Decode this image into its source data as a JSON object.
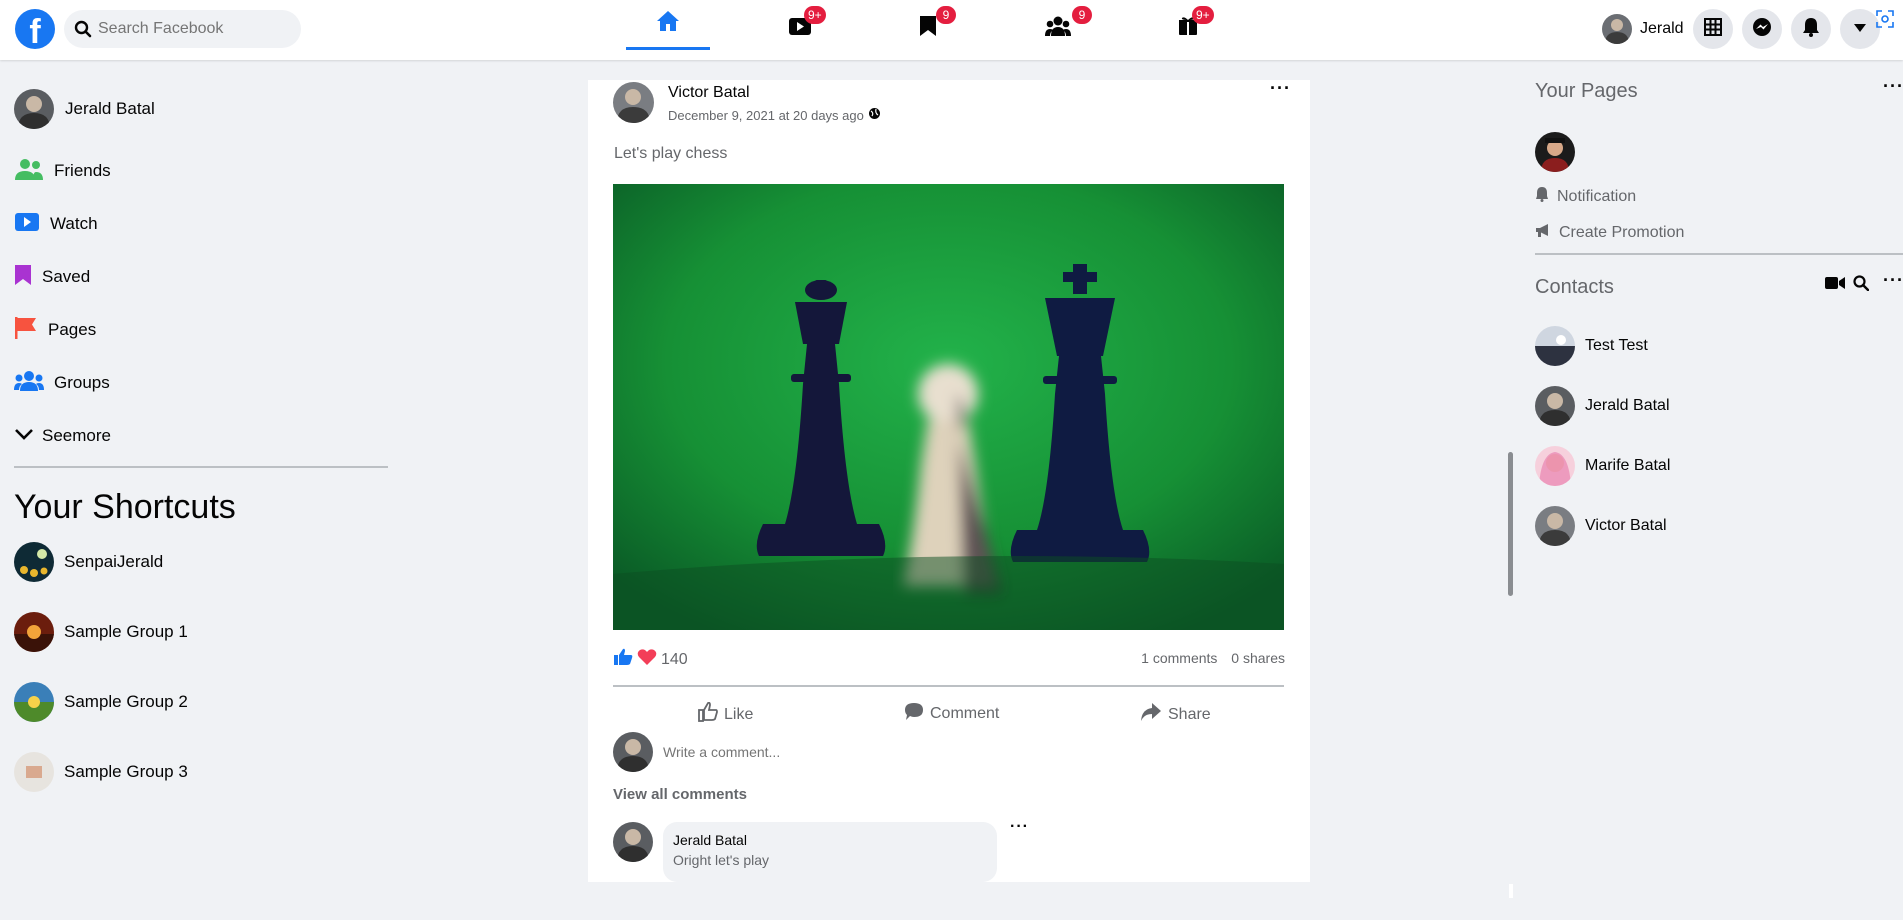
{
  "header": {
    "logo_letter": "f",
    "search_placeholder": "Search Facebook",
    "tabs": [
      {
        "name": "home",
        "badge": ""
      },
      {
        "name": "watch",
        "badge": "9+"
      },
      {
        "name": "saved",
        "badge": "9"
      },
      {
        "name": "groups",
        "badge": "9"
      },
      {
        "name": "gaming",
        "badge": "9+"
      }
    ],
    "user_name": "Jerald"
  },
  "sidebar": {
    "profile_name": "Jerald Batal",
    "items": [
      {
        "label": "Friends",
        "icon": "friends-icon",
        "color": "#45bd62"
      },
      {
        "label": "Watch",
        "icon": "watch-icon",
        "color": "#1877f2"
      },
      {
        "label": "Saved",
        "icon": "saved-icon",
        "color": "#a933d1"
      },
      {
        "label": "Pages",
        "icon": "pages-icon",
        "color": "#f7533f"
      },
      {
        "label": "Groups",
        "icon": "groups-icon",
        "color": "#1877f2"
      },
      {
        "label": "Seemore",
        "icon": "chevron-down-icon",
        "color": "#050505"
      }
    ],
    "shortcuts_title": "Your Shortcuts",
    "shortcuts": [
      {
        "label": "SenpaiJerald"
      },
      {
        "label": "Sample Group 1"
      },
      {
        "label": "Sample Group 2"
      },
      {
        "label": "Sample Group 3"
      }
    ]
  },
  "post": {
    "author": "Victor Batal",
    "date": "December 9, 2021 at 20 days ago",
    "text": "Let's play chess",
    "reaction_count": "140",
    "comments_count": "1 comments",
    "shares_count": "0 shares",
    "actions": {
      "like": "Like",
      "comment": "Comment",
      "share": "Share"
    },
    "comment_placeholder": "Write a comment...",
    "view_all": "View all comments",
    "comment": {
      "author": "Jerald Batal",
      "text": "Oright let's play"
    }
  },
  "right": {
    "pages_title": "Your Pages",
    "page_links": [
      {
        "label": "Notification",
        "icon": "bell-icon"
      },
      {
        "label": "Create Promotion",
        "icon": "megaphone-icon"
      }
    ],
    "contacts_title": "Contacts",
    "contacts": [
      {
        "name": "Test Test"
      },
      {
        "name": "Jerald Batal"
      },
      {
        "name": "Marife Batal"
      },
      {
        "name": "Victor Batal"
      }
    ]
  },
  "colors": {
    "brand": "#1877f2",
    "badge": "#e41e3f",
    "background": "#f0f2f5"
  }
}
